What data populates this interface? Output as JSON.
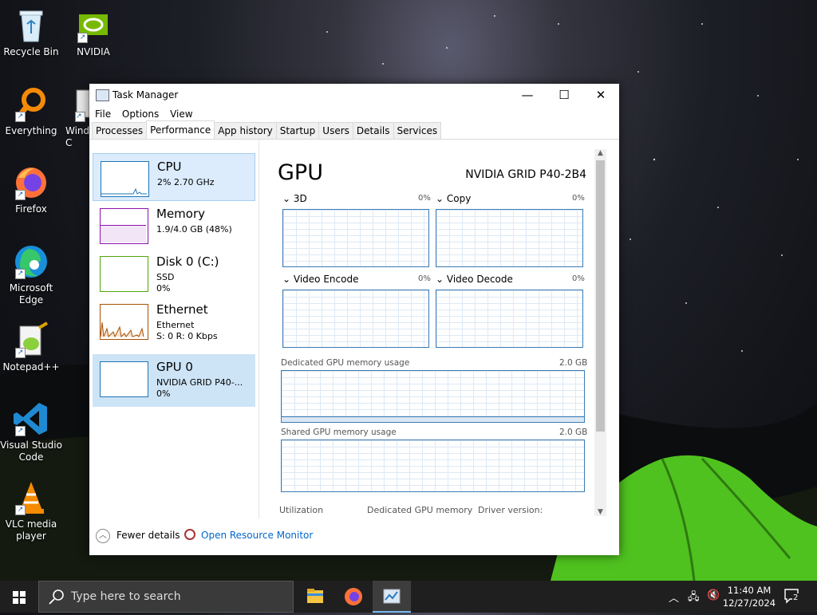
{
  "desktop": {
    "icons": [
      {
        "label": "Recycle Bin"
      },
      {
        "label": "NVIDIA"
      },
      {
        "label": "Everything"
      },
      {
        "label": "Windows C"
      },
      {
        "label": "Firefox"
      },
      {
        "label": "Microsoft Edge"
      },
      {
        "label": "Notepad++"
      },
      {
        "label": "Visual Studio Code"
      },
      {
        "label": "VLC media player"
      }
    ]
  },
  "window": {
    "title": "Task Manager",
    "controls": {
      "minimize": "—",
      "maximize": "☐",
      "close": "✕"
    },
    "menu": [
      "File",
      "Options",
      "View"
    ],
    "tabs": [
      "Processes",
      "Performance",
      "App history",
      "Startup",
      "Users",
      "Details",
      "Services"
    ],
    "active_tab": "Performance"
  },
  "left_panel": {
    "items": [
      {
        "title": "CPU",
        "line1": "2%  2.70 GHz",
        "line2": "",
        "color": "#1e75b4"
      },
      {
        "title": "Memory",
        "line1": "1.9/4.0 GB (48%)",
        "line2": "",
        "color": "#8b12ae"
      },
      {
        "title": "Disk 0 (C:)",
        "line1": "SSD",
        "line2": "0%",
        "color": "#4da60c"
      },
      {
        "title": "Ethernet",
        "line1": "Ethernet",
        "line2": "S: 0  R: 0 Kbps",
        "color": "#a74f01"
      },
      {
        "title": "GPU 0",
        "line1": "NVIDIA GRID P40-...",
        "line2": "0%",
        "color": "#1e75b4"
      }
    ],
    "selected": "GPU 0"
  },
  "gpu_panel": {
    "title": "GPU",
    "device": "NVIDIA GRID P40-2B4",
    "engines": [
      {
        "label": "3D",
        "pct": "0%"
      },
      {
        "label": "Copy",
        "pct": "0%"
      },
      {
        "label": "Video Encode",
        "pct": "0%"
      },
      {
        "label": "Video Decode",
        "pct": "0%"
      }
    ],
    "dedicated_label": "Dedicated GPU memory usage",
    "dedicated_max": "2.0 GB",
    "shared_label": "Shared GPU memory usage",
    "shared_max": "2.0 GB",
    "stats_labels": [
      "Utilization",
      "Dedicated GPU memory",
      "Driver version:"
    ]
  },
  "footer": {
    "fewer_details": "Fewer details",
    "open_resource_monitor": "Open Resource Monitor"
  },
  "taskbar": {
    "search_placeholder": "Type here to search",
    "time": "11:40 AM",
    "date": "12/27/2024",
    "notification_count": "2"
  }
}
